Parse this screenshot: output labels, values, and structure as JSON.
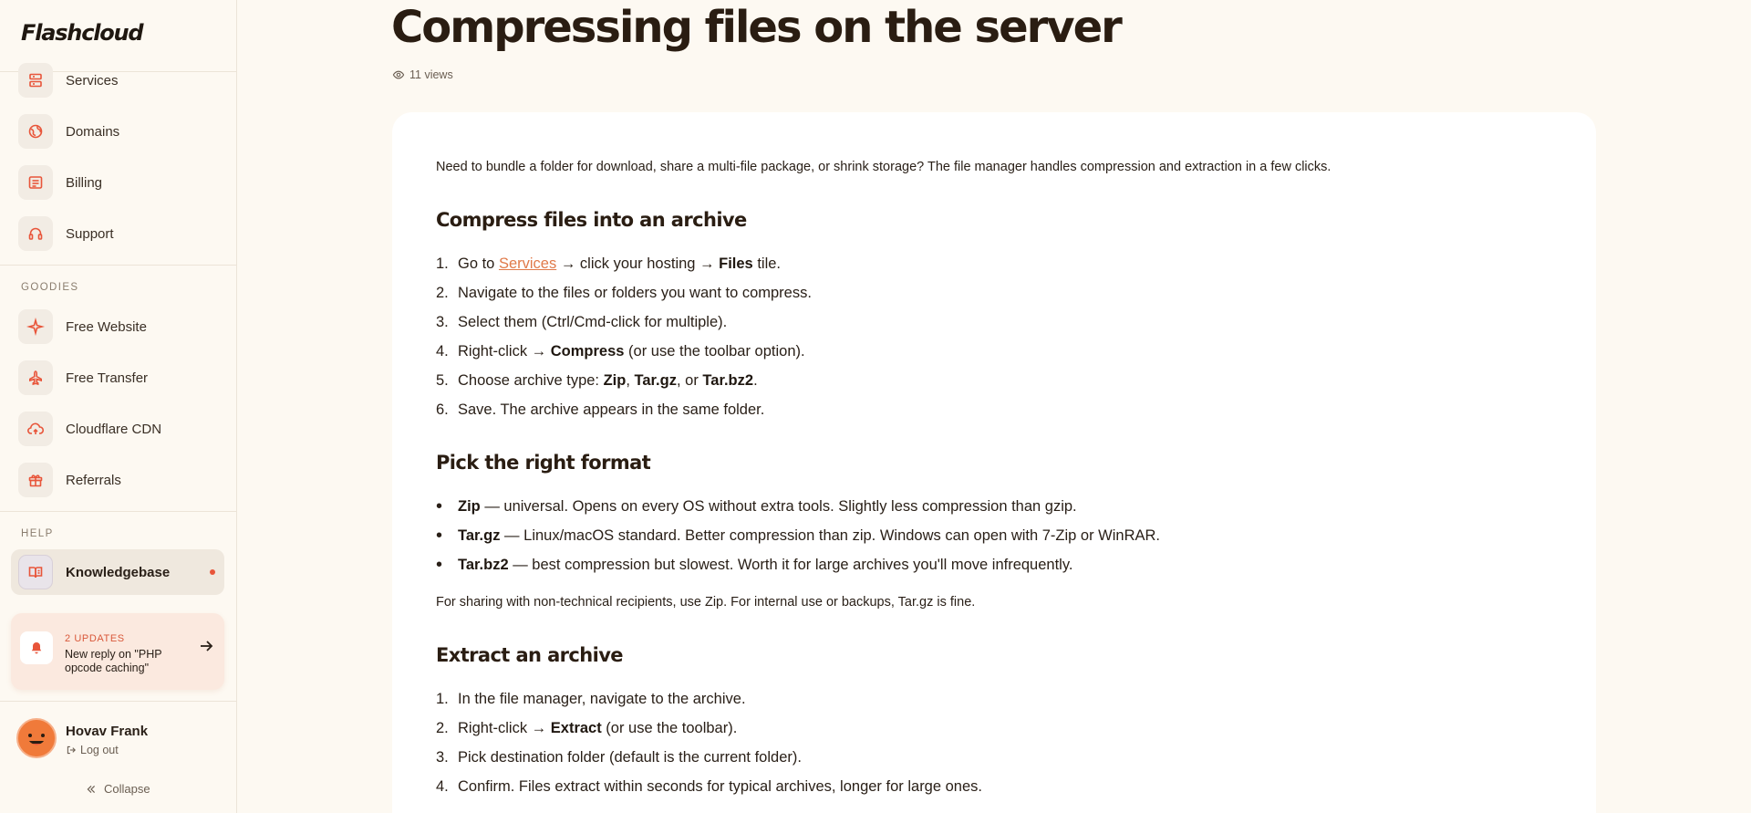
{
  "brand": {
    "logo": "Flashcloud",
    "accent": "#e8553a"
  },
  "sidebar": {
    "main_items": [
      {
        "label": "Services",
        "icon": "server-icon"
      },
      {
        "label": "Domains",
        "icon": "globe-icon"
      },
      {
        "label": "Billing",
        "icon": "invoice-icon"
      },
      {
        "label": "Support",
        "icon": "headset-icon"
      }
    ],
    "goodies_title": "GOODIES",
    "goodies_items": [
      {
        "label": "Free Website",
        "icon": "sparkle-icon"
      },
      {
        "label": "Free Transfer",
        "icon": "plane-icon"
      },
      {
        "label": "Cloudflare CDN",
        "icon": "cloud-upload-icon"
      },
      {
        "label": "Referrals",
        "icon": "gift-icon"
      }
    ],
    "help_title": "HELP",
    "help_items": [
      {
        "label": "Knowledgebase",
        "icon": "book-icon",
        "active": true,
        "has_dot": true
      }
    ],
    "updates": {
      "title": "2 UPDATES",
      "text": "New reply on \"PHP opcode caching\""
    },
    "user": {
      "name": "Hovav Frank",
      "logout": "Log out"
    },
    "collapse": "Collapse"
  },
  "article": {
    "title": "Compressing files on the server",
    "views": "11 views",
    "intro": "Need to bundle a folder for download, share a multi-file package, or shrink storage? The file manager handles compression and extraction in a few clicks.",
    "sections": [
      {
        "heading": "Compress files into an archive",
        "steps": [
          {
            "num": "1.",
            "a": "Go to ",
            "link": "Services",
            "b": " → click your hosting → ",
            "bold": "Files",
            "c": " tile."
          },
          {
            "num": "2.",
            "a": "Navigate to the files or folders you want to compress."
          },
          {
            "num": "3.",
            "a": "Select them (Ctrl/Cmd-click for multiple)."
          },
          {
            "num": "4.",
            "a": "Right-click → ",
            "bold": "Compress",
            "c": " (or use the toolbar option)."
          },
          {
            "num": "5.",
            "a": "Choose archive type: ",
            "bold": "Zip",
            "c": ", ",
            "bold2": "Tar.gz",
            "d": ", or ",
            "bold3": "Tar.bz2",
            "e": "."
          },
          {
            "num": "6.",
            "a": "Save. The archive appears in the same folder."
          }
        ]
      },
      {
        "heading": "Pick the right format",
        "bullets": [
          {
            "bold": "Zip",
            "text": " — universal. Opens on every OS without extra tools. Slightly less compression than gzip."
          },
          {
            "bold": "Tar.gz",
            "text": " — Linux/macOS standard. Better compression than zip. Windows can open with 7-Zip or WinRAR."
          },
          {
            "bold": "Tar.bz2",
            "text": " — best compression but slowest. Worth it for large archives you'll move infrequently."
          }
        ],
        "note": "For sharing with non-technical recipients, use Zip. For internal use or backups, Tar.gz is fine."
      },
      {
        "heading": "Extract an archive",
        "steps": [
          {
            "num": "1.",
            "a": "In the file manager, navigate to the archive."
          },
          {
            "num": "2.",
            "a": "Right-click → ",
            "bold": "Extract",
            "c": " (or use the toolbar)."
          },
          {
            "num": "3.",
            "a": "Pick destination folder (default is the current folder)."
          },
          {
            "num": "4.",
            "a": "Confirm. Files extract within seconds for typical archives, longer for large ones."
          }
        ]
      }
    ]
  }
}
